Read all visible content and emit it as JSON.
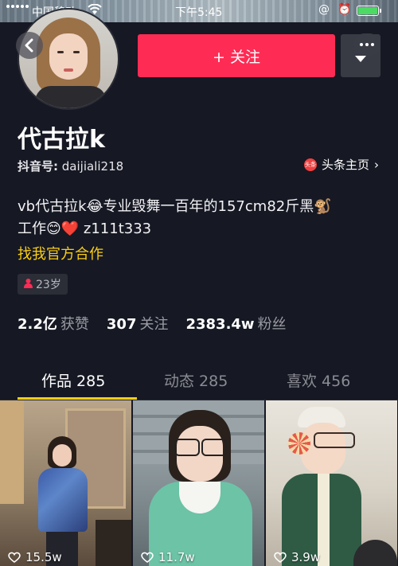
{
  "status_bar": {
    "carrier": "中国移动",
    "time": "下午5:45"
  },
  "profile": {
    "name": "代古拉k",
    "douyin_id_label": "抖音号:",
    "douyin_id": "daijiali218",
    "toutiao_label": "头条主页",
    "toutiao_icon_text": "头条",
    "bio_line1": "vb代古拉k😂专业毁舞一百年的157cm82斤黑🐒",
    "bio_line2": "工作😊❤️ z111t333",
    "bio_link": "找我官方合作",
    "age": "23岁"
  },
  "actions": {
    "follow_label": "+ 关注",
    "more_icon": "dots-icon",
    "back_icon": "chevron-left-icon"
  },
  "stats": {
    "likes_num": "2.2亿",
    "likes_label": "获赞",
    "following_num": "307",
    "following_label": "关注",
    "followers_num": "2383.4w",
    "followers_label": "粉丝"
  },
  "tabs": [
    {
      "label": "作品 285",
      "active": true
    },
    {
      "label": "动态 285",
      "active": false
    },
    {
      "label": "喜欢 456",
      "active": false
    }
  ],
  "videos": [
    {
      "likes": "15.5w"
    },
    {
      "likes": "11.7w"
    },
    {
      "likes": "3.9w"
    }
  ],
  "colors": {
    "background": "#161823",
    "accent_red": "#fe2c55",
    "accent_yellow": "#face15"
  }
}
